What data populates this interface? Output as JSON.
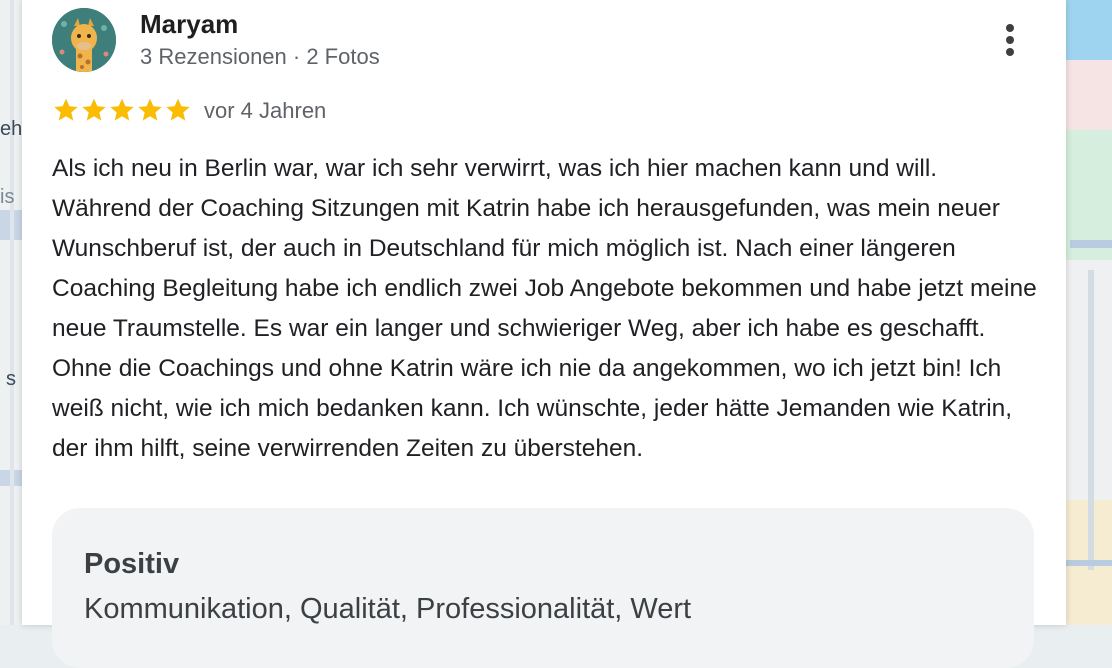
{
  "reviewer": {
    "name": "Maryam",
    "stats": "3 Rezensionen · 2 Fotos",
    "avatar_icon": "giraffe-avatar"
  },
  "rating": {
    "stars": 5,
    "max": 5,
    "time": "vor 4 Jahren",
    "star_color": "#fbbc04"
  },
  "review_text": "Als ich neu in Berlin war, war ich sehr verwirrt, was ich hier machen kann und will. Während der Coaching Sitzungen mit Katrin habe ich herausgefunden, was mein neuer Wunschberuf ist, der auch in Deutschland für mich möglich ist. Nach einer längeren Coaching Begleitung habe ich endlich zwei Job Angebote bekommen und habe jetzt meine neue Traumstelle. Es war ein langer und schwieriger Weg, aber ich habe es geschafft. Ohne die Coachings und ohne Katrin wäre ich nie da angekommen, wo ich jetzt bin! Ich weiß nicht, wie ich mich bedanken kann. Ich wünschte, jeder hätte Jemanden wie Katrin, der ihm hilft, seine verwirrenden Zeiten zu überstehen.",
  "positive": {
    "title": "Positiv",
    "items": "Kommunikation, Qualität, Professionalität, Wert"
  },
  "map_fragments": {
    "left_labels": [
      "eh",
      "is",
      "s"
    ]
  },
  "icons": {
    "more": "more-vert-icon",
    "star": "star-icon"
  }
}
